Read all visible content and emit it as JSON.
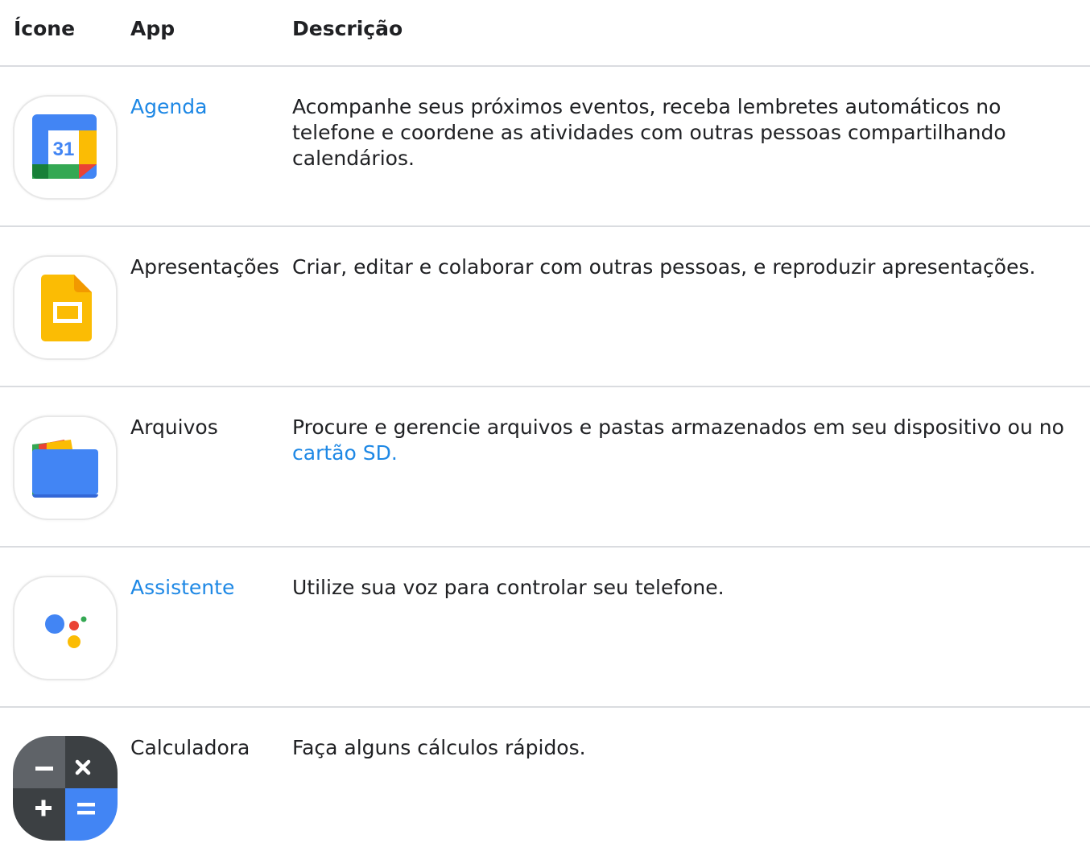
{
  "headers": {
    "icon": "Ícone",
    "app": "App",
    "description": "Descrição"
  },
  "rows": [
    {
      "icon": "google-calendar-icon",
      "app": "Agenda",
      "app_is_link": true,
      "description": "Acompanhe seus próximos eventos, receba lembretes automáticos no telefone e coordene as atividades com outras pessoas compartilhando calendários.",
      "calendar_day": "31"
    },
    {
      "icon": "google-slides-icon",
      "app": "Apresentações",
      "app_is_link": false,
      "description": "Criar, editar e colaborar com outras pessoas, e reproduzir apresentações."
    },
    {
      "icon": "files-icon",
      "app": "Arquivos",
      "app_is_link": false,
      "description": "Procure e gerencie arquivos e pastas armazenados em seu dispositivo ou no ",
      "description_link": "cartão SD."
    },
    {
      "icon": "google-assistant-icon",
      "app": "Assistente",
      "app_is_link": true,
      "description": "Utilize sua voz para controlar seu telefone."
    },
    {
      "icon": "calculator-icon",
      "app": "Calculadora",
      "app_is_link": false,
      "description": "Faça alguns cálculos rápidos."
    }
  ],
  "colors": {
    "link": "#1e88e5",
    "text": "#202124",
    "divider": "#dadce0",
    "google_blue": "#4285f4",
    "google_red": "#ea4335",
    "google_yellow": "#fbbc04",
    "google_green": "#34a853"
  }
}
